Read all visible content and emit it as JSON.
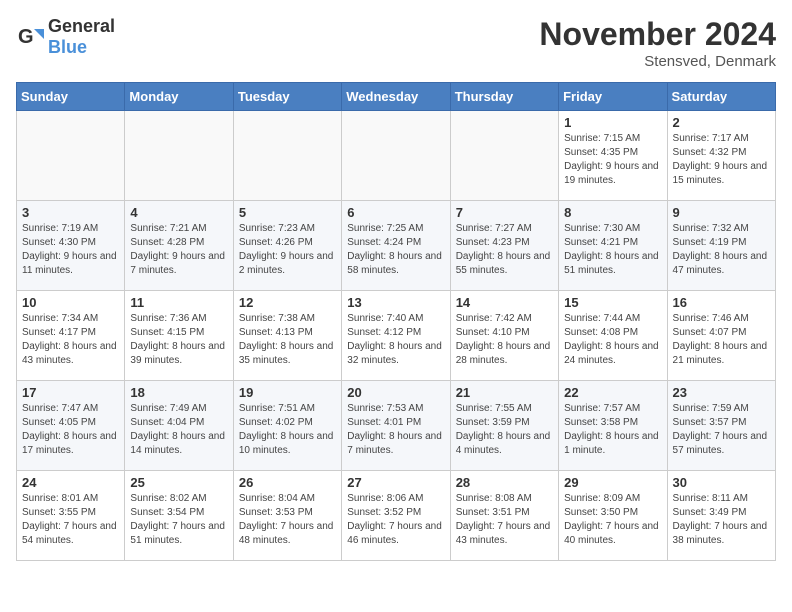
{
  "header": {
    "logo_general": "General",
    "logo_blue": "Blue",
    "title": "November 2024",
    "location": "Stensved, Denmark"
  },
  "weekdays": [
    "Sunday",
    "Monday",
    "Tuesday",
    "Wednesday",
    "Thursday",
    "Friday",
    "Saturday"
  ],
  "weeks": [
    [
      {
        "day": "",
        "info": ""
      },
      {
        "day": "",
        "info": ""
      },
      {
        "day": "",
        "info": ""
      },
      {
        "day": "",
        "info": ""
      },
      {
        "day": "",
        "info": ""
      },
      {
        "day": "1",
        "info": "Sunrise: 7:15 AM\nSunset: 4:35 PM\nDaylight: 9 hours and 19 minutes."
      },
      {
        "day": "2",
        "info": "Sunrise: 7:17 AM\nSunset: 4:32 PM\nDaylight: 9 hours and 15 minutes."
      }
    ],
    [
      {
        "day": "3",
        "info": "Sunrise: 7:19 AM\nSunset: 4:30 PM\nDaylight: 9 hours and 11 minutes."
      },
      {
        "day": "4",
        "info": "Sunrise: 7:21 AM\nSunset: 4:28 PM\nDaylight: 9 hours and 7 minutes."
      },
      {
        "day": "5",
        "info": "Sunrise: 7:23 AM\nSunset: 4:26 PM\nDaylight: 9 hours and 2 minutes."
      },
      {
        "day": "6",
        "info": "Sunrise: 7:25 AM\nSunset: 4:24 PM\nDaylight: 8 hours and 58 minutes."
      },
      {
        "day": "7",
        "info": "Sunrise: 7:27 AM\nSunset: 4:23 PM\nDaylight: 8 hours and 55 minutes."
      },
      {
        "day": "8",
        "info": "Sunrise: 7:30 AM\nSunset: 4:21 PM\nDaylight: 8 hours and 51 minutes."
      },
      {
        "day": "9",
        "info": "Sunrise: 7:32 AM\nSunset: 4:19 PM\nDaylight: 8 hours and 47 minutes."
      }
    ],
    [
      {
        "day": "10",
        "info": "Sunrise: 7:34 AM\nSunset: 4:17 PM\nDaylight: 8 hours and 43 minutes."
      },
      {
        "day": "11",
        "info": "Sunrise: 7:36 AM\nSunset: 4:15 PM\nDaylight: 8 hours and 39 minutes."
      },
      {
        "day": "12",
        "info": "Sunrise: 7:38 AM\nSunset: 4:13 PM\nDaylight: 8 hours and 35 minutes."
      },
      {
        "day": "13",
        "info": "Sunrise: 7:40 AM\nSunset: 4:12 PM\nDaylight: 8 hours and 32 minutes."
      },
      {
        "day": "14",
        "info": "Sunrise: 7:42 AM\nSunset: 4:10 PM\nDaylight: 8 hours and 28 minutes."
      },
      {
        "day": "15",
        "info": "Sunrise: 7:44 AM\nSunset: 4:08 PM\nDaylight: 8 hours and 24 minutes."
      },
      {
        "day": "16",
        "info": "Sunrise: 7:46 AM\nSunset: 4:07 PM\nDaylight: 8 hours and 21 minutes."
      }
    ],
    [
      {
        "day": "17",
        "info": "Sunrise: 7:47 AM\nSunset: 4:05 PM\nDaylight: 8 hours and 17 minutes."
      },
      {
        "day": "18",
        "info": "Sunrise: 7:49 AM\nSunset: 4:04 PM\nDaylight: 8 hours and 14 minutes."
      },
      {
        "day": "19",
        "info": "Sunrise: 7:51 AM\nSunset: 4:02 PM\nDaylight: 8 hours and 10 minutes."
      },
      {
        "day": "20",
        "info": "Sunrise: 7:53 AM\nSunset: 4:01 PM\nDaylight: 8 hours and 7 minutes."
      },
      {
        "day": "21",
        "info": "Sunrise: 7:55 AM\nSunset: 3:59 PM\nDaylight: 8 hours and 4 minutes."
      },
      {
        "day": "22",
        "info": "Sunrise: 7:57 AM\nSunset: 3:58 PM\nDaylight: 8 hours and 1 minute."
      },
      {
        "day": "23",
        "info": "Sunrise: 7:59 AM\nSunset: 3:57 PM\nDaylight: 7 hours and 57 minutes."
      }
    ],
    [
      {
        "day": "24",
        "info": "Sunrise: 8:01 AM\nSunset: 3:55 PM\nDaylight: 7 hours and 54 minutes."
      },
      {
        "day": "25",
        "info": "Sunrise: 8:02 AM\nSunset: 3:54 PM\nDaylight: 7 hours and 51 minutes."
      },
      {
        "day": "26",
        "info": "Sunrise: 8:04 AM\nSunset: 3:53 PM\nDaylight: 7 hours and 48 minutes."
      },
      {
        "day": "27",
        "info": "Sunrise: 8:06 AM\nSunset: 3:52 PM\nDaylight: 7 hours and 46 minutes."
      },
      {
        "day": "28",
        "info": "Sunrise: 8:08 AM\nSunset: 3:51 PM\nDaylight: 7 hours and 43 minutes."
      },
      {
        "day": "29",
        "info": "Sunrise: 8:09 AM\nSunset: 3:50 PM\nDaylight: 7 hours and 40 minutes."
      },
      {
        "day": "30",
        "info": "Sunrise: 8:11 AM\nSunset: 3:49 PM\nDaylight: 7 hours and 38 minutes."
      }
    ]
  ]
}
